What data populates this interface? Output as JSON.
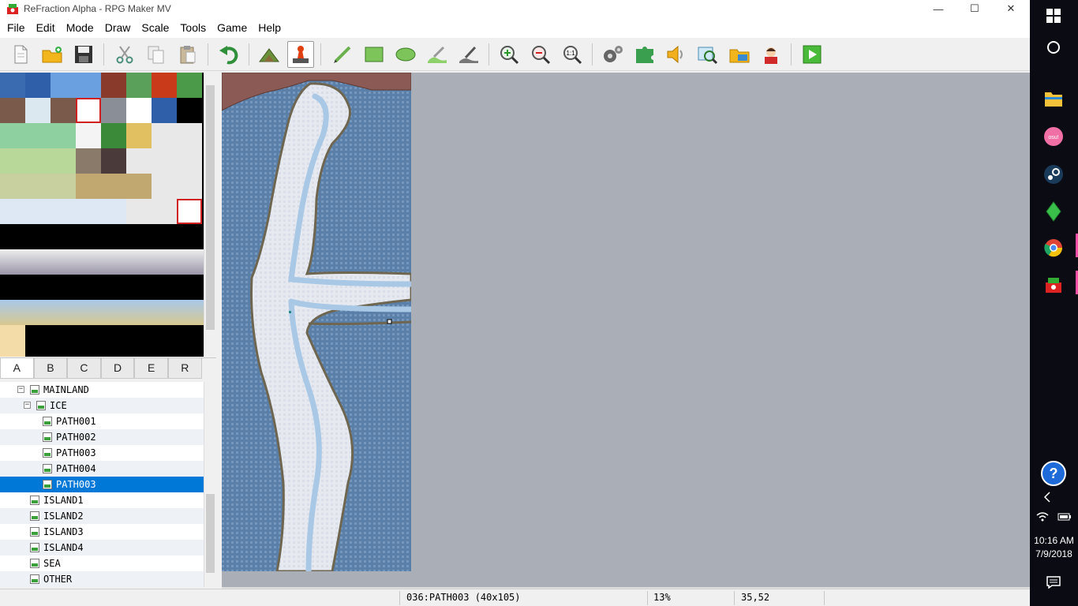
{
  "window": {
    "title": "ReFraction Alpha - RPG Maker MV",
    "minimize_glyph": "—",
    "maximize_glyph": "☐",
    "close_glyph": "✕"
  },
  "menu": [
    "File",
    "Edit",
    "Mode",
    "Draw",
    "Scale",
    "Tools",
    "Game",
    "Help"
  ],
  "toolbar": {
    "icons": [
      "new-project-icon",
      "open-project-icon",
      "save-project-icon",
      "cut-icon",
      "copy-icon",
      "paste-icon",
      "undo-icon",
      "map-mode-icon",
      "event-mode-icon",
      "pencil-icon",
      "rectangle-icon",
      "ellipse-icon",
      "flood-fill-icon",
      "shadow-pen-icon",
      "zoom-in-icon",
      "zoom-out-icon",
      "actual-size-icon",
      "database-icon",
      "plugin-manager-icon",
      "sound-test-icon",
      "event-searcher-icon",
      "resource-manager-icon",
      "character-generator-icon",
      "playtest-icon"
    ],
    "zoom_1to1_label": "1:1"
  },
  "tileset_tabs": [
    {
      "label": "A",
      "active": true
    },
    {
      "label": "B",
      "active": false
    },
    {
      "label": "C",
      "active": false
    },
    {
      "label": "D",
      "active": false
    },
    {
      "label": "E",
      "active": false
    },
    {
      "label": "R",
      "active": false
    }
  ],
  "map_tree": [
    {
      "label": "MAINLAND",
      "level": 0,
      "expander": "−"
    },
    {
      "label": "ICE",
      "level": 1,
      "expander": "−"
    },
    {
      "label": "PATH001",
      "level": 2
    },
    {
      "label": "PATH002",
      "level": 2
    },
    {
      "label": "PATH003",
      "level": 2
    },
    {
      "label": "PATH004",
      "level": 2
    },
    {
      "label": "PATH003",
      "level": 2,
      "selected": true
    },
    {
      "label": "ISLAND1",
      "level": 1
    },
    {
      "label": "ISLAND2",
      "level": 1
    },
    {
      "label": "ISLAND3",
      "level": 1
    },
    {
      "label": "ISLAND4",
      "level": 1
    },
    {
      "label": "SEA",
      "level": 1
    },
    {
      "label": "OTHER",
      "level": 1
    }
  ],
  "status": {
    "map_info": "036:PATH003 (40x105)",
    "zoom": "13%",
    "coords": "35,52"
  },
  "taskbar": {
    "time": "10:16 AM",
    "date": "7/9/2018",
    "apps": [
      "windows-start-icon",
      "cortana-icon",
      "file-explorer-icon",
      "osu-icon",
      "steam-icon",
      "sims-icon",
      "chrome-icon",
      "rpg-maker-icon"
    ],
    "osu_label": "osu!"
  },
  "colors": {
    "selection": "#0078d7",
    "map_background": "#aaaeb6",
    "water": "#5a7fa8",
    "ice": "#e6eaf0"
  }
}
